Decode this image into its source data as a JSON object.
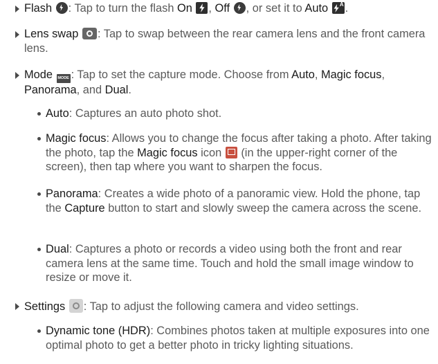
{
  "items": {
    "flash": {
      "term": "Flash",
      "t1": ": Tap to turn the flash ",
      "on": "On",
      "sep1": ", ",
      "off": "Off",
      "sep2": ", or set it to ",
      "auto": "Auto",
      "end": "."
    },
    "lens": {
      "term": "Lens swap",
      "t1": ": Tap to swap between the rear camera lens and the front camera lens."
    },
    "mode": {
      "term": "Mode",
      "icon_text": "MODE",
      "t1": ": Tap to set the capture mode. Choose from ",
      "o1": "Auto",
      "s1": ", ",
      "o2": "Magic focus",
      "s2": ", ",
      "o3": "Panorama",
      "s3": ", and ",
      "o4": "Dual",
      "end": "."
    },
    "settings": {
      "term": "Settings",
      "t1": ": Tap to adjust the following camera and video settings."
    }
  },
  "modes": {
    "auto": {
      "term": "Auto",
      "t1": ": Captures an auto photo shot."
    },
    "magic": {
      "term": "Magic focus",
      "t1": ": Allows you to change the focus after taking a photo. After taking the photo, tap the ",
      "term2": "Magic focus",
      "t2": " icon ",
      "t3": " (in the upper-right corner of the screen), then tap where you want to sharpen the focus."
    },
    "panorama": {
      "term": "Panorama",
      "t1": ": Creates a wide photo of a panoramic view. Hold the phone, tap the ",
      "term2": "Capture",
      "t2": " button to start and slowly sweep the camera across the scene."
    },
    "dual": {
      "term": "Dual",
      "t1": ": Captures a photo or records a video using both the front and rear camera lens at the same time. Touch and hold the small image window to resize or move it."
    }
  },
  "settings_sub": {
    "hdr": {
      "term": "Dynamic tone (HDR)",
      "t1": ": Combines photos taken at multiple exposures into one optimal photo to get a better photo in tricky lighting situations."
    }
  },
  "icons": {
    "flash": "flash-off-icon",
    "on": "flash-on-icon",
    "off": "flash-off-icon",
    "auto": "flash-auto-icon",
    "lens": "lens-swap-icon",
    "mode": "mode-icon",
    "magic": "magic-focus-icon",
    "settings": "settings-gear-icon"
  }
}
